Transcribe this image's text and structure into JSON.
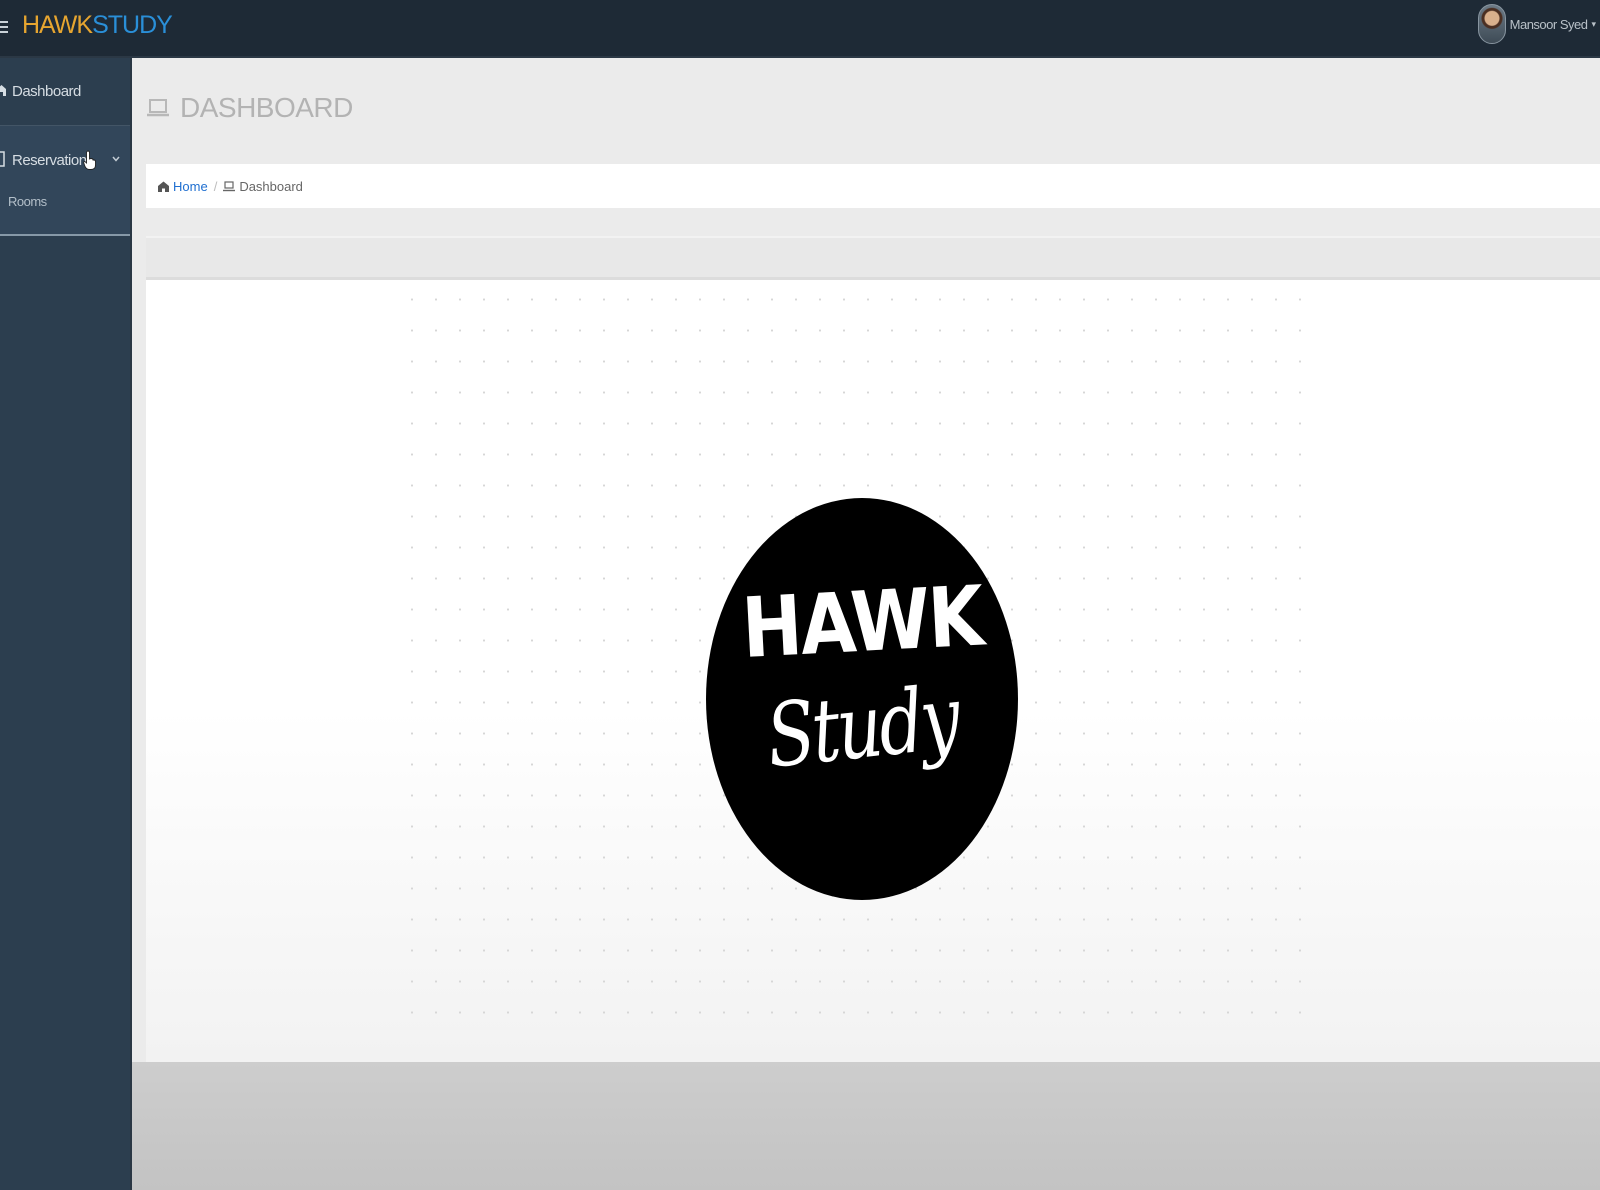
{
  "header": {
    "brand_part1": "HAWK",
    "brand_part2": "STUDY",
    "user_name": "Mansoor Syed",
    "user_caret": "▾",
    "menu_icon": "hamburger-icon"
  },
  "sidebar": {
    "items": [
      {
        "label": "Dashboard",
        "icon": "home-icon"
      },
      {
        "label": "Reservation",
        "icon": "book-icon",
        "expanded": true,
        "children": [
          {
            "label": "Rooms"
          }
        ]
      }
    ]
  },
  "page": {
    "title": "DASHBOARD",
    "title_icon": "laptop-icon"
  },
  "breadcrumb": {
    "home": "Home",
    "current": "Dashboard",
    "separator": "/"
  },
  "logo": {
    "line1": "HAWK",
    "line2": "Study"
  },
  "colors": {
    "topbar_bg": "#1e2a36",
    "sidebar_bg": "#2c3e4f",
    "brand_orange": "#e6a530",
    "brand_blue": "#2a8fd8",
    "link_blue": "#1f6fd0",
    "content_bg": "#ebebeb"
  }
}
